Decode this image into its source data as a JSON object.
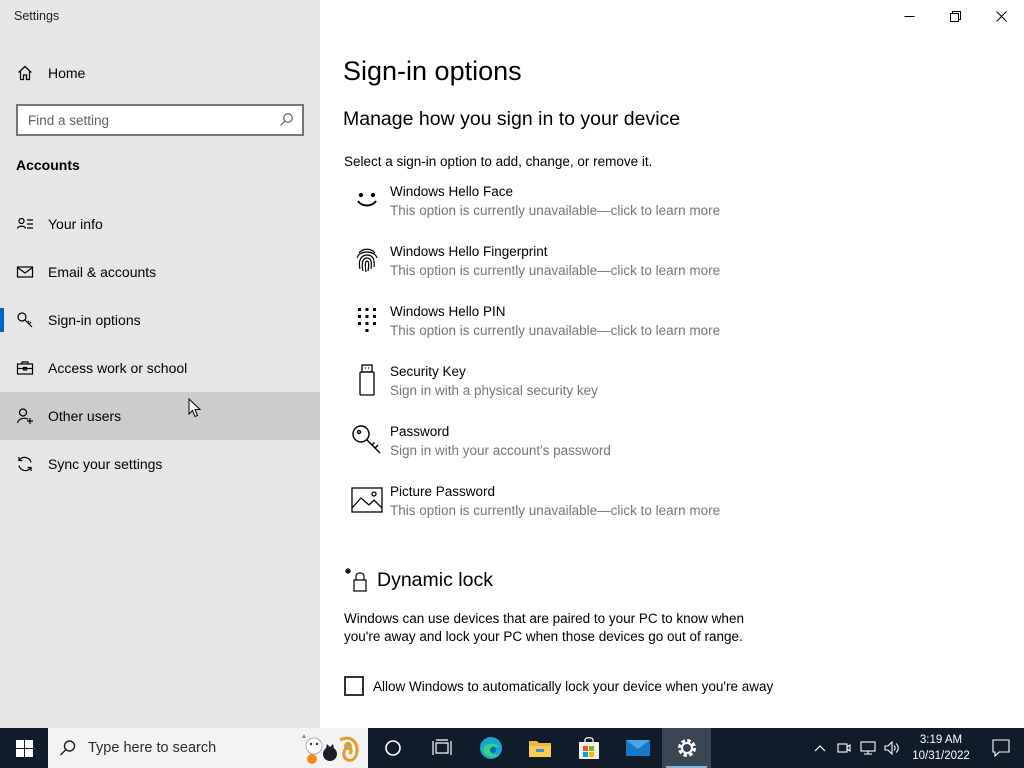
{
  "window": {
    "title": "Settings",
    "controls": {
      "minimize": "minimize",
      "maximize": "restore",
      "close": "close"
    }
  },
  "sidebar": {
    "home_label": "Home",
    "search_placeholder": "Find a setting",
    "section_title": "Accounts",
    "items": [
      {
        "label": "Your info",
        "icon": "contact-card-icon",
        "selected": false,
        "hover": false
      },
      {
        "label": "Email & accounts",
        "icon": "mail-icon",
        "selected": false,
        "hover": false
      },
      {
        "label": "Sign-in options",
        "icon": "key-icon",
        "selected": true,
        "hover": false
      },
      {
        "label": "Access work or school",
        "icon": "briefcase-icon",
        "selected": false,
        "hover": false
      },
      {
        "label": "Other users",
        "icon": "add-person-icon",
        "selected": false,
        "hover": true
      },
      {
        "label": "Sync your settings",
        "icon": "sync-icon",
        "selected": false,
        "hover": false
      }
    ]
  },
  "main": {
    "page_title": "Sign-in options",
    "subheading": "Manage how you sign in to your device",
    "instruction": "Select a sign-in option to add, change, or remove it.",
    "options": [
      {
        "name": "Windows Hello Face",
        "desc": "This option is currently unavailable—click to learn more",
        "icon": "smiley-face-icon"
      },
      {
        "name": "Windows Hello Fingerprint",
        "desc": "This option is currently unavailable—click to learn more",
        "icon": "fingerprint-icon"
      },
      {
        "name": "Windows Hello PIN",
        "desc": "This option is currently unavailable—click to learn more",
        "icon": "pin-pad-icon"
      },
      {
        "name": "Security Key",
        "desc": "Sign in with a physical security key",
        "icon": "usb-key-icon"
      },
      {
        "name": "Password",
        "desc": "Sign in with your account's password",
        "icon": "key-icon"
      },
      {
        "name": "Picture Password",
        "desc": "This option is currently unavailable—click to learn more",
        "icon": "picture-icon"
      }
    ],
    "dynamic_lock": {
      "title": "Dynamic lock",
      "description": "Windows can use devices that are paired to your PC to know when you're away and lock your PC when those devices go out of range.",
      "checkbox_label": "Allow Windows to automatically lock your device when you're away",
      "checked": false
    }
  },
  "taskbar": {
    "search_placeholder": "Type here to search",
    "apps": [
      "cortana-icon",
      "task-view-icon",
      "edge-icon",
      "file-explorer-icon",
      "store-icon",
      "mail-icon",
      "settings-icon"
    ],
    "active_app": "settings-icon",
    "time": "3:19 AM",
    "date": "10/31/2022"
  },
  "colors": {
    "accent": "#0067c0",
    "sidebar_bg": "#e6e6e6",
    "taskbar_bg": "#101c2a",
    "muted_text": "#767676"
  }
}
